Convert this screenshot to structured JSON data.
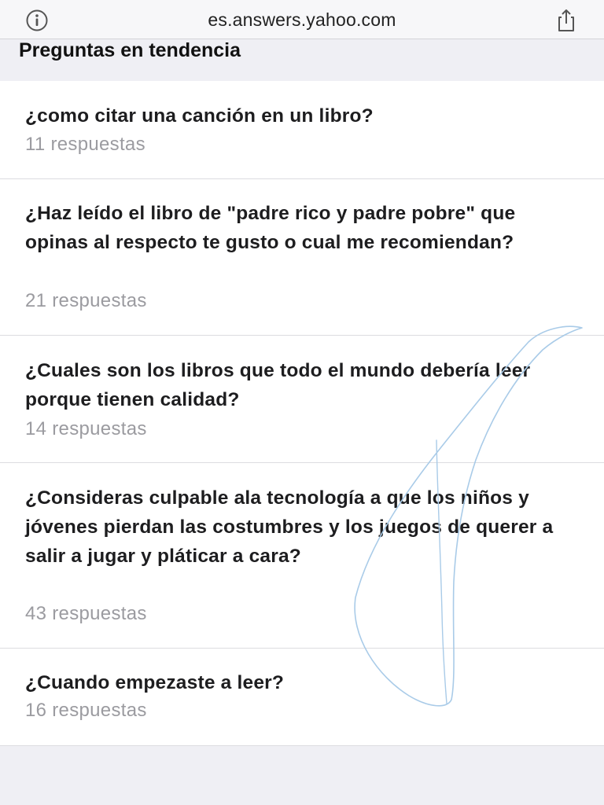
{
  "browser": {
    "url": "es.answers.yahoo.com"
  },
  "section": {
    "title": "Preguntas en tendencia"
  },
  "questions": [
    {
      "title": "¿como citar una canción en un libro?",
      "count": "11 respuestas"
    },
    {
      "title": "¿Haz leído el libro de \"padre rico y padre pobre\" que opinas al respecto te gusto o cual me recomiendan?",
      "count": "21 respuestas"
    },
    {
      "title": "¿Cuales son los libros que todo el mundo debería leer porque tienen calidad?",
      "count": "14 respuestas"
    },
    {
      "title": "¿Consideras culpable ala tecnología a que los niños y jóvenes pierdan las costumbres y los juegos de querer a salir a jugar y pláticar a cara?",
      "count": "43 respuestas"
    },
    {
      "title": "¿Cuando empezaste a leer?",
      "count": "16 respuestas"
    }
  ],
  "icons": {
    "info": "info-icon",
    "share": "share-icon"
  },
  "colors": {
    "scribble": "#a9cbe8",
    "muted_text": "#9b9ba0",
    "background": "#efeff4"
  }
}
